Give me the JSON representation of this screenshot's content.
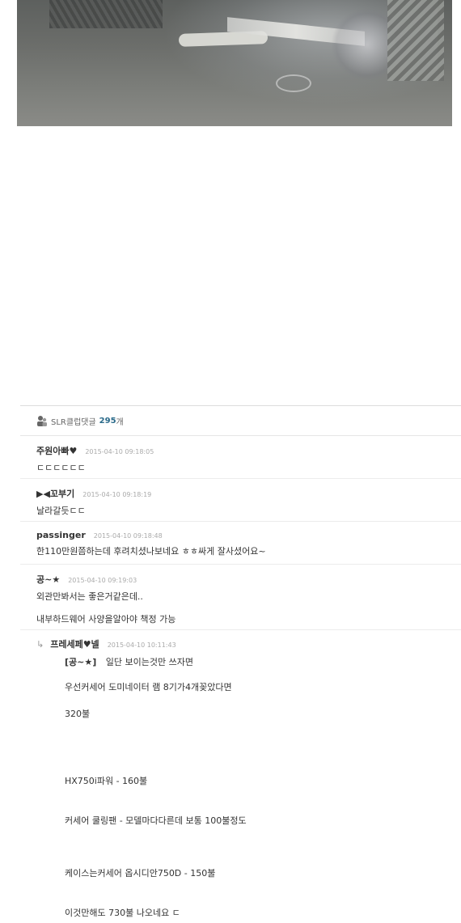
{
  "comments_header": {
    "label": "SLR클럽댓글",
    "count": "295",
    "count_unit": "개"
  },
  "comments": [
    {
      "author": "주원아빠♥",
      "date": "2015-04-10 09:18:05",
      "lines": [
        "ㄷㄷㄷㄷㄷㄷ"
      ]
    },
    {
      "author": "▶◀꼬부기",
      "date": "2015-04-10 09:18:19",
      "lines": [
        "날라갈듯ㄷㄷ"
      ]
    },
    {
      "author": "passinger",
      "date": "2015-04-10 09:18:48",
      "lines": [
        "한110만원쯤하는데 후려치셨나보네요 ㅎㅎ싸게 잘사셨어요~"
      ]
    },
    {
      "author": "공~★",
      "date": "2015-04-10 09:19:03",
      "lines": [
        "외관만봐서는 좋은거같은데..",
        "내부하드웨어 사양을알아야 책정 가능"
      ]
    }
  ],
  "reply": {
    "arrow": "↳",
    "author": "프레세페♥넬",
    "date": "2015-04-10 10:11:43",
    "tag": "[공~★]",
    "first_line": "일단 보이는것만 쓰자면",
    "lines": [
      "우선커세어 도미네이터 램 8기가4개꽂았다면",
      "320불",
      "HX750i파워 - 160불",
      "커세어 쿨링팬 - 모델마다다른데 보통 100불정도",
      "케이스는커세어 옵시디안750D - 150불",
      "이것만해도 730불 나오네요 ㄷ"
    ]
  }
}
